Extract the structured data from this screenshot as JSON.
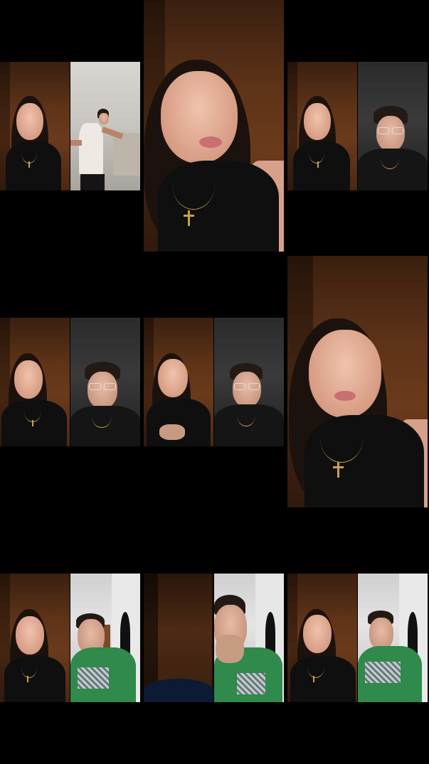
{
  "tiles": [
    {
      "id": "row1-split-left",
      "desc": ""
    },
    {
      "id": "row1-solo-center",
      "desc": ""
    },
    {
      "id": "row1-split-right",
      "desc": ""
    },
    {
      "id": "row2-split-left",
      "desc": ""
    },
    {
      "id": "row2-split-center",
      "desc": ""
    },
    {
      "id": "row2-solo-right",
      "desc": ""
    },
    {
      "id": "row3-split-left",
      "desc": ""
    },
    {
      "id": "row3-split-center",
      "desc": ""
    },
    {
      "id": "row3-split-right",
      "desc": ""
    }
  ]
}
